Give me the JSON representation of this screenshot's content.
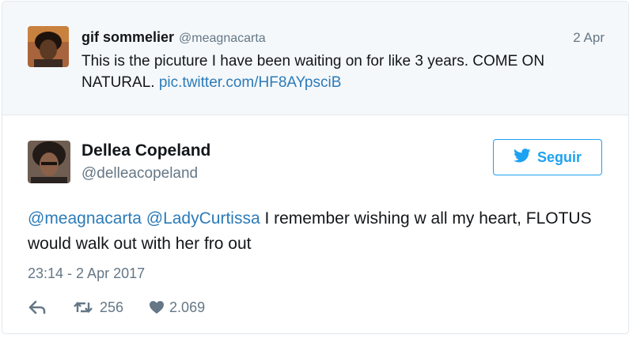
{
  "parent_tweet": {
    "author_name": "gif sommelier",
    "handle": "@meagnacarta",
    "date": "2 Apr",
    "text_plain": "This is the picuture I have been waiting on for like 3 years. COME ON NATURAL.",
    "link": "pic.twitter.com/HF8AYpsciB"
  },
  "main_tweet": {
    "author_name": "Dellea Copeland",
    "handle": "@delleacopeland",
    "follow_label": "Seguir",
    "mention_1": "@meagnacarta",
    "mention_2": "@LadyCurtissa",
    "text": "I remember wishing w all my heart, FLOTUS would walk out with her fro out",
    "timestamp": "23:14 - 2 Apr 2017",
    "retweet_count": "256",
    "like_count": "2.069"
  },
  "colors": {
    "link": "#2b7bb9",
    "brand": "#1da1f2",
    "muted": "#657786",
    "parent_bg": "#f5f8fa"
  },
  "icons": {
    "reply": "reply-icon",
    "retweet": "retweet-icon",
    "like": "heart-icon",
    "follow": "twitter-bird-icon"
  }
}
